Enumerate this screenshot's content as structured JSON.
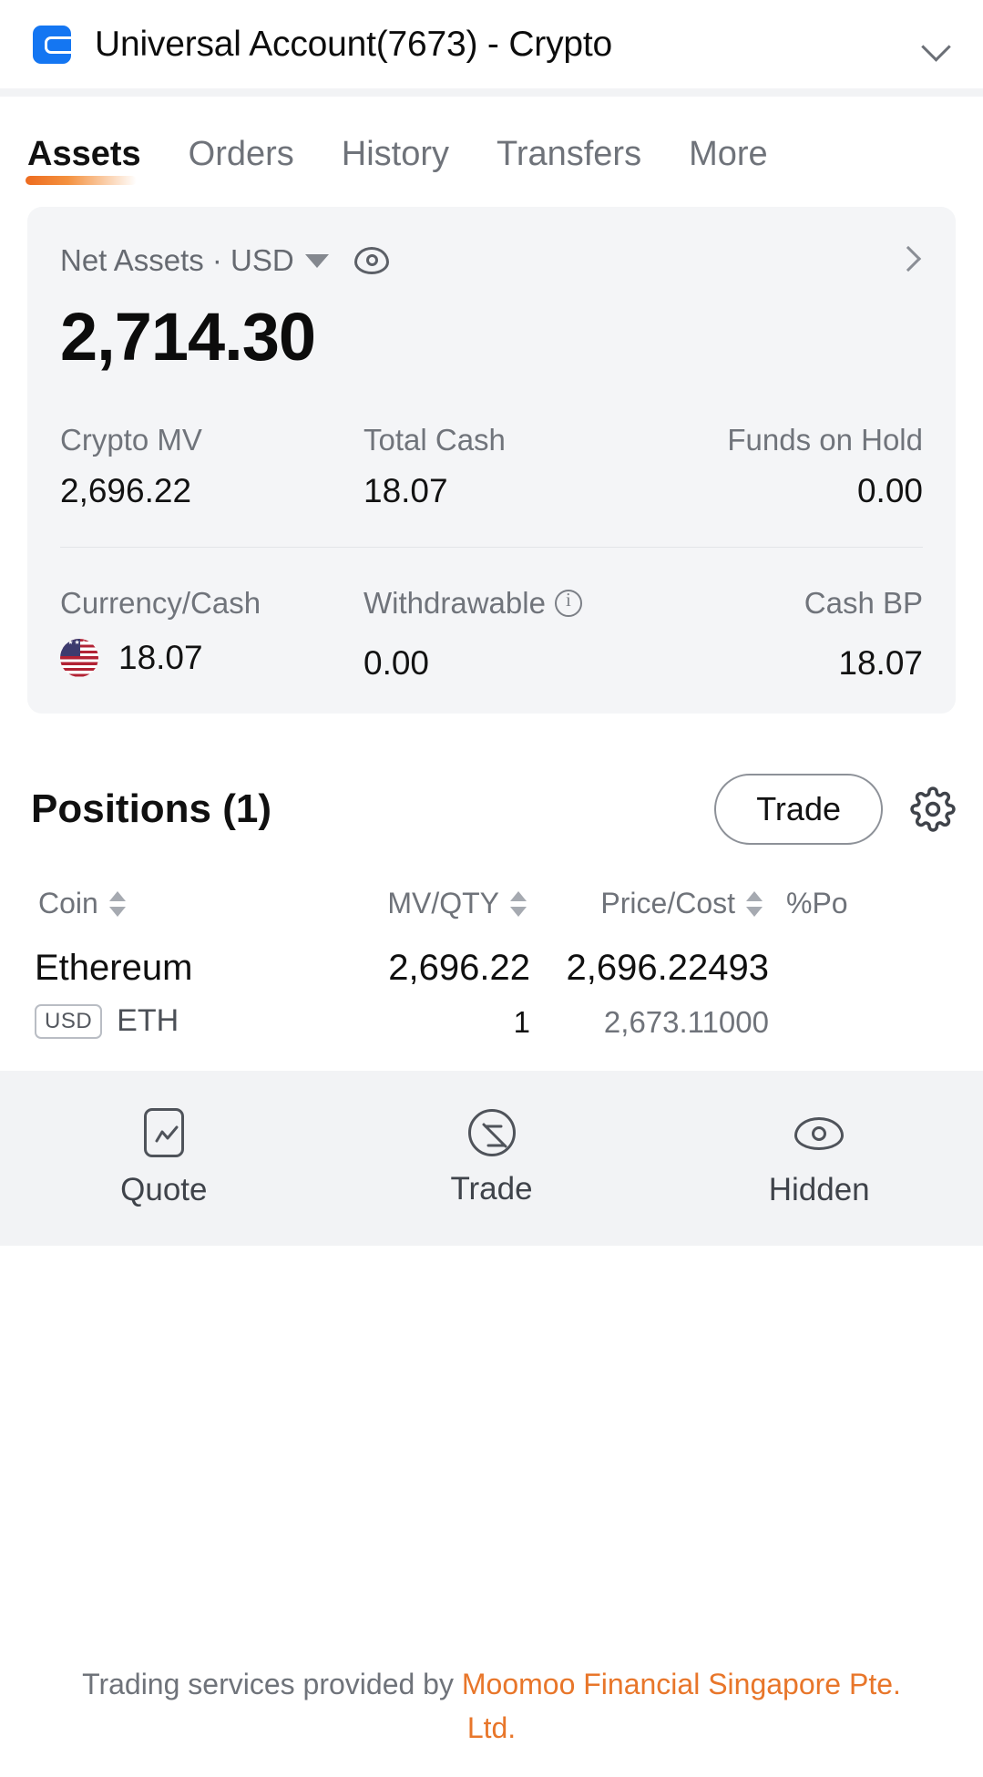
{
  "header": {
    "account_title": "Universal Account(7673) - Crypto",
    "account_icon": "wallet-icon",
    "dropdown_icon": "chevron-down-icon"
  },
  "tabs": [
    {
      "label": "Assets",
      "active": true
    },
    {
      "label": "Orders",
      "active": false
    },
    {
      "label": "History",
      "active": false
    },
    {
      "label": "Transfers",
      "active": false
    },
    {
      "label": "More",
      "active": false
    }
  ],
  "net_assets": {
    "label": "Net Assets · USD",
    "currency_selector_icon": "triangle-down-icon",
    "visibility_icon": "eye-icon",
    "detail_icon": "chevron-right-icon",
    "value": "2,714.30",
    "stats_primary": [
      {
        "label": "Crypto MV",
        "value": "2,696.22"
      },
      {
        "label": "Total Cash",
        "value": "18.07"
      },
      {
        "label": "Funds on Hold",
        "value": "0.00"
      }
    ],
    "stats_secondary": [
      {
        "label": "Currency/Cash",
        "value": "18.07",
        "icon": "us-flag-icon"
      },
      {
        "label": "Withdrawable",
        "value": "0.00",
        "icon": "info-icon"
      },
      {
        "label": "Cash BP",
        "value": "18.07"
      }
    ]
  },
  "positions": {
    "title": "Positions (1)",
    "trade_button": "Trade",
    "settings_icon": "gear-icon",
    "columns": [
      {
        "label": "Coin",
        "sort_icon": "sort-arrows-icon"
      },
      {
        "label": "MV/QTY",
        "sort_icon": "sort-arrows-icon"
      },
      {
        "label": "Price/Cost",
        "sort_icon": "sort-arrows-icon"
      },
      {
        "label": "%Po"
      }
    ],
    "rows": [
      {
        "name": "Ethereum",
        "badge": "USD",
        "ticker": "ETH",
        "mv": "2,696.22",
        "qty": "1",
        "price": "2,696.22493",
        "cost": "2,673.11000"
      }
    ]
  },
  "action_bar": [
    {
      "label": "Quote",
      "icon": "quote-chart-icon"
    },
    {
      "label": "Trade",
      "icon": "trade-circle-icon"
    },
    {
      "label": "Hidden",
      "icon": "eye-icon"
    }
  ],
  "footer": {
    "prefix": "Trading services provided by ",
    "brand": "Moomoo Financial Singapore Pte. Ltd."
  },
  "colors": {
    "accent_orange": "#E8762A",
    "brand_blue": "#1476F2",
    "card_bg": "#f4f5f7"
  }
}
